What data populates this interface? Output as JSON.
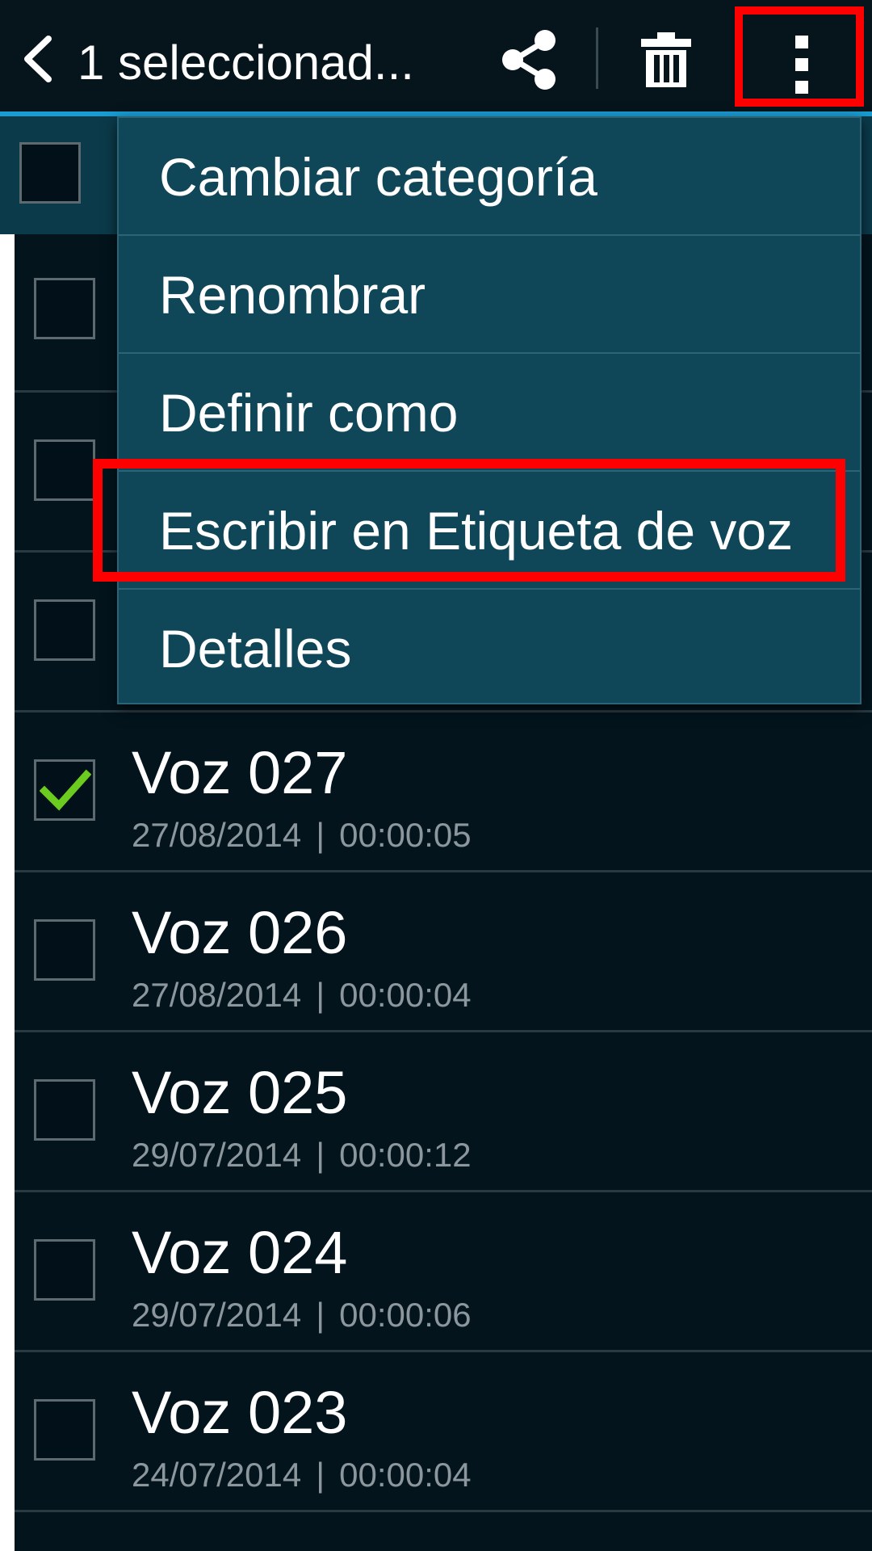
{
  "actionbar": {
    "title": "1 seleccionad...",
    "accent_color": "#1b9bd0",
    "highlight_color": "#ff0000"
  },
  "menu": {
    "items": [
      {
        "label": "Cambiar categoría"
      },
      {
        "label": "Renombrar"
      },
      {
        "label": "Definir como"
      },
      {
        "label": "Escribir en Etiqueta de voz"
      },
      {
        "label": "Detalles"
      }
    ]
  },
  "recordings": [
    {
      "name": "Voz 027",
      "date": "27/08/2014",
      "duration": "00:00:05",
      "checked": true
    },
    {
      "name": "Voz 026",
      "date": "27/08/2014",
      "duration": "00:00:04",
      "checked": false
    },
    {
      "name": "Voz 025",
      "date": "29/07/2014",
      "duration": "00:00:12",
      "checked": false
    },
    {
      "name": "Voz 024",
      "date": "29/07/2014",
      "duration": "00:00:06",
      "checked": false
    },
    {
      "name": "Voz 023",
      "date": "24/07/2014",
      "duration": "00:00:04",
      "checked": false
    }
  ],
  "separator": "|"
}
